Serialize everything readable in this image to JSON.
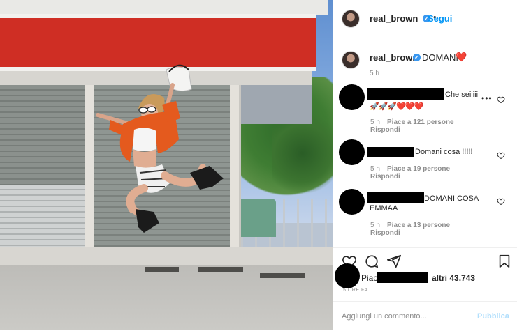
{
  "post": {
    "username": "real_brown",
    "follow_label": "Segui",
    "separator": "•",
    "caption_text": "DOMANI",
    "caption_emoji": "❤️",
    "caption_time": "5 h"
  },
  "comments": [
    {
      "text": "Che seiiiii",
      "emoji": "🚀🚀🚀❤️❤️❤️",
      "time": "5 h",
      "likes": "Piace a 121 persone",
      "reply": "Rispondi"
    },
    {
      "text": "Domani cosa !!!!!",
      "time": "5 h",
      "likes": "Piace a 19 persone",
      "reply": "Rispondi"
    },
    {
      "text_line1": "DOMANI COSA",
      "text_line2": "EMMAA",
      "time": "5 h",
      "likes": "Piace a 13 persone",
      "reply": "Rispondi"
    }
  ],
  "actions": {
    "icons": [
      "heart-icon",
      "comment-icon",
      "share-icon",
      "bookmark-icon"
    ]
  },
  "likes_summary": {
    "prefix": "Piac",
    "suffix": "altri 43.743",
    "time": "5 ORE FA"
  },
  "add_comment": {
    "placeholder": "Aggiungi un commento...",
    "publish_label": "Pubblica"
  },
  "colors": {
    "link_blue": "#0095f6",
    "verified_blue": "#3897f0",
    "heart_red": "#ed4956",
    "publish_disabled": "#b2dffc"
  }
}
